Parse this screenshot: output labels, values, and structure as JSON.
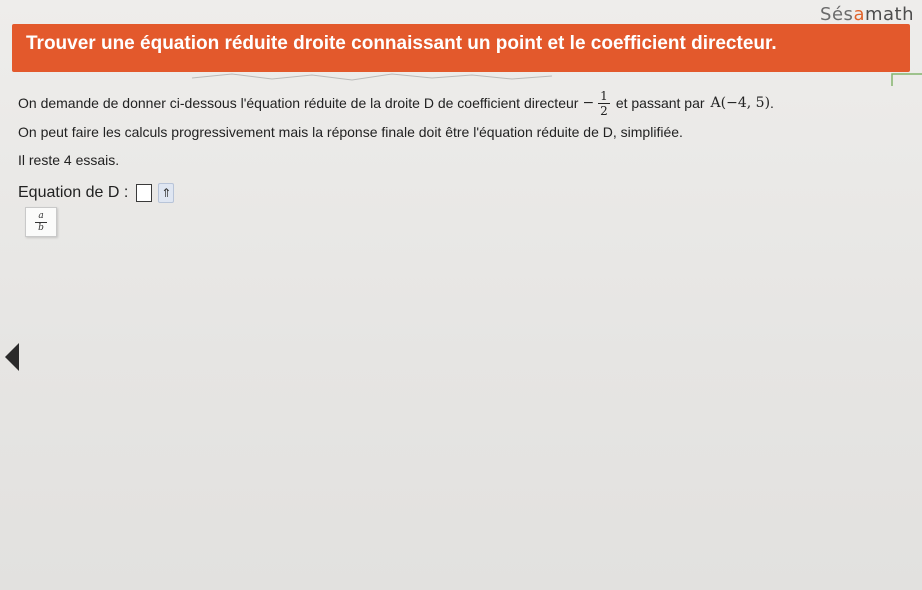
{
  "brand": {
    "part1": "Sés",
    "part2": "a",
    "part3": "math"
  },
  "header": {
    "title": "Trouver une équation réduite droite connaissant un point et le coefficient directeur."
  },
  "statement": {
    "intro": "On demande de donner ci-dessous l'équation réduite de la droite D de coefficient directeur",
    "minus": "−",
    "numerator": "1",
    "denominator": "2",
    "middle": "et passant par",
    "point": "A(−4, 5)",
    "period": ".",
    "line2": "On peut faire les calculs progressivement mais la réponse finale doit être l'équation réduite de D, simplifiée.",
    "line3": "Il reste 4 essais."
  },
  "answer": {
    "label": "Equation de D :",
    "keyboard_icon": "⇑"
  },
  "toolbar": {
    "fraction_num": "a",
    "fraction_den": "b"
  },
  "colors": {
    "header_bg": "#e3592c",
    "header_text": "#ffffff",
    "brand_accent": "#e0632b"
  },
  "icons": {
    "nav": "left-arrow-icon",
    "keyboard": "keyboard-toggle-icon",
    "fraction": "fraction-icon"
  }
}
